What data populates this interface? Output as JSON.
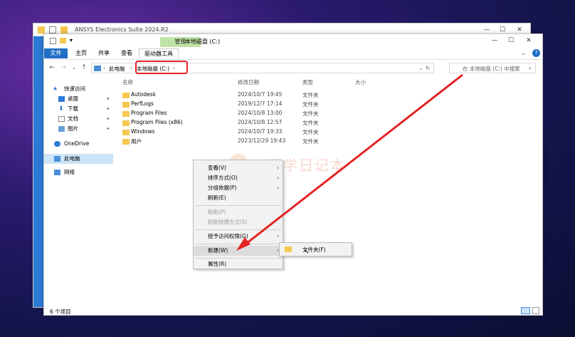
{
  "back_window": {
    "title": "ANSYS Electronics Suite 2024.R2",
    "controls": [
      "—",
      "☐",
      "✕"
    ]
  },
  "front_window": {
    "title": "本地磁盘 (C:)",
    "manage_tab": "管理",
    "controls": [
      "—",
      "☐",
      "✕"
    ],
    "ribbon": {
      "file": "文件",
      "home": "主页",
      "share": "共享",
      "view": "查看",
      "drive_tools": "驱动器工具"
    },
    "address": {
      "crumb1": "此电脑",
      "crumb2": "本地磁盘 (C:)"
    },
    "search_placeholder": "在 本地磁盘 (C:) 中搜索",
    "sidebar": {
      "quick": "快速访问",
      "desktop": "桌面",
      "downloads": "下载",
      "documents": "文档",
      "pictures": "图片",
      "onedrive": "OneDrive",
      "thispc": "此电脑",
      "network": "网络"
    },
    "columns": {
      "name": "名称",
      "date": "修改日期",
      "type": "类型",
      "size": "大小"
    },
    "files": [
      {
        "name": "Autodesk",
        "date": "2024/10/7 19:45",
        "type": "文件夹"
      },
      {
        "name": "PerfLogs",
        "date": "2019/12/7 17:14",
        "type": "文件夹"
      },
      {
        "name": "Program Files",
        "date": "2024/10/8 13:00",
        "type": "文件夹"
      },
      {
        "name": "Program Files (x86)",
        "date": "2024/10/8 12:57",
        "type": "文件夹"
      },
      {
        "name": "Windows",
        "date": "2024/10/7 19:33",
        "type": "文件夹"
      },
      {
        "name": "用户",
        "date": "2023/12/29 19:43",
        "type": "文件夹"
      }
    ],
    "status": "6 个项目"
  },
  "context_menu": {
    "view": "查看(V)",
    "sort": "排序方式(O)",
    "group": "分组依据(P)",
    "refresh": "刷新(E)",
    "paste": "粘贴(P)",
    "paste_shortcut": "粘贴快捷方式(S)",
    "access": "授予访问权限(G)",
    "new": "新建(W)",
    "properties": "属性(R)"
  },
  "submenu": {
    "folder": "文件夹(F)"
  },
  "watermark": "丁司学日记本",
  "colors": {
    "accent": "#1f6fc5",
    "highlight": "#e42323",
    "arrow": "#e42323"
  }
}
